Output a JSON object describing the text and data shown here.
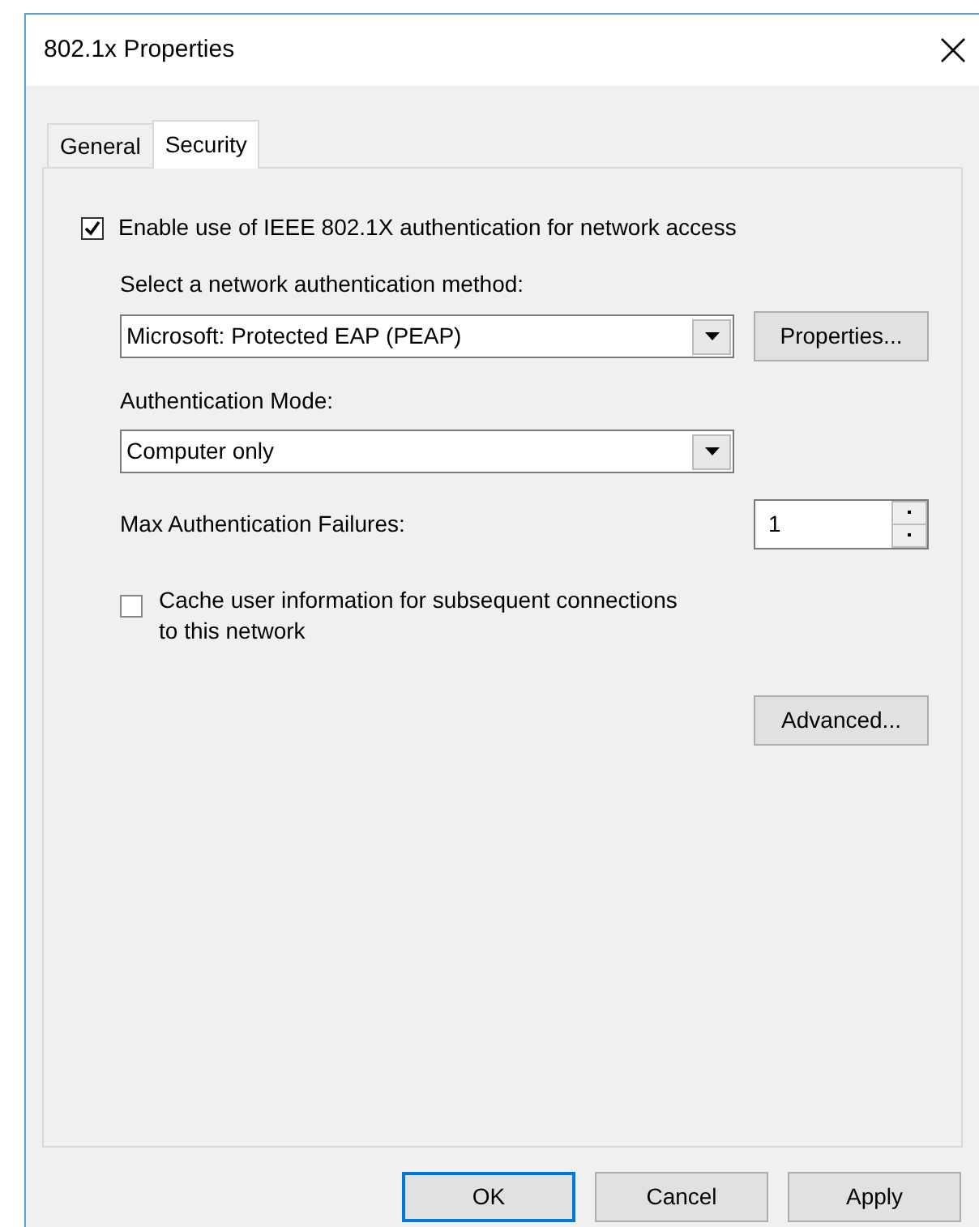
{
  "window": {
    "title": "802.1x Properties"
  },
  "tabs": [
    {
      "label": "General",
      "selected": false
    },
    {
      "label": "Security",
      "selected": true
    }
  ],
  "enable_auth": {
    "label": "Enable use of IEEE 802.1X authentication for network access",
    "checked": true
  },
  "method": {
    "label": "Select a network authentication method:",
    "value": "Microsoft: Protected EAP (PEAP)",
    "button": "Properties..."
  },
  "mode": {
    "label": "Authentication Mode:",
    "value": "Computer only"
  },
  "max_failures": {
    "label": "Max Authentication Failures:",
    "value": "1"
  },
  "cache": {
    "label": "Cache user information for subsequent connections to this network",
    "checked": false
  },
  "advanced_button": "Advanced...",
  "buttons": [
    {
      "label": "OK",
      "selected": true
    },
    {
      "label": "Cancel",
      "selected": false
    },
    {
      "label": "Apply",
      "selected": false
    }
  ]
}
